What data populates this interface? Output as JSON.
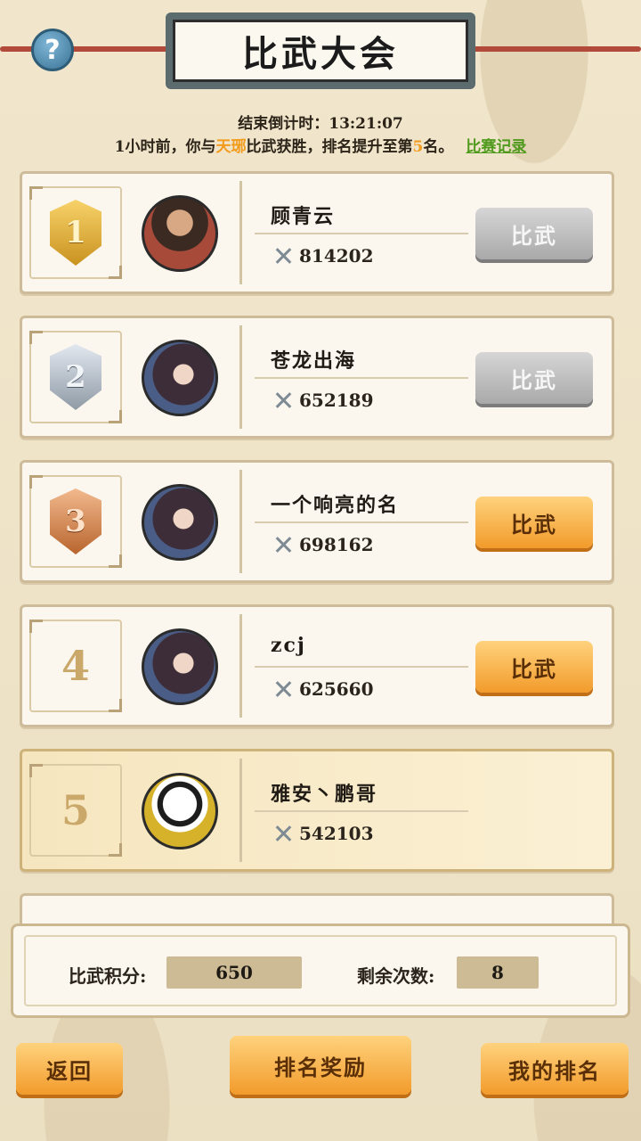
{
  "header": {
    "title": "比武大会",
    "help_label": "?",
    "countdown_label": "结束倒计时：",
    "countdown_value": "13:21:07",
    "notice_prefix": "1小时前，你与",
    "notice_opponent": "天琊",
    "notice_mid": "比武获胜，排名提升至第",
    "notice_rank": "5",
    "notice_suffix": "名。",
    "record_link": "比赛记录"
  },
  "rows": [
    {
      "rank": "1",
      "name": "顾青云",
      "power": "814202",
      "button": "比武",
      "button_state": "disabled",
      "avatar": "warrior"
    },
    {
      "rank": "2",
      "name": "苍龙出海",
      "power": "652189",
      "button": "比武",
      "button_state": "disabled",
      "avatar": "lady"
    },
    {
      "rank": "3",
      "name": "一个响亮的名",
      "power": "698162",
      "button": "比武",
      "button_state": "active",
      "avatar": "lady"
    },
    {
      "rank": "4",
      "name": "zcj",
      "power": "625660",
      "button": "比武",
      "button_state": "active",
      "avatar": "lady"
    },
    {
      "rank": "5",
      "name": "雅安丶鹏哥",
      "power": "542103",
      "button": "",
      "button_state": "none",
      "avatar": "panda"
    }
  ],
  "stats": {
    "score_label": "比武积分:",
    "score_value": "650",
    "remaining_label": "剩余次数:",
    "remaining_value": "8"
  },
  "footer": {
    "back_label": "返回",
    "reward_label": "排名奖励",
    "my_rank_label": "我的排名"
  },
  "colors": {
    "accent_orange": "#f29b1d",
    "link_green": "#4f9a1c",
    "background": "#efe3c8"
  }
}
